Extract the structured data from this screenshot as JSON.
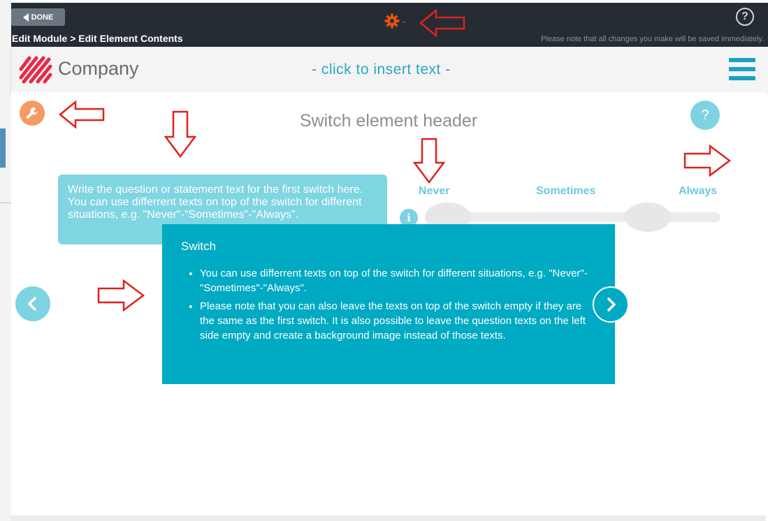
{
  "toolbar": {
    "done_label": "DONE",
    "breadcrumb": "Edit Module > Edit Element Contents",
    "help_label": "?",
    "save_note": "Please note that all changes you make will be saved immediately."
  },
  "header": {
    "company_name": "Company",
    "insert_text": "- click to insert text -"
  },
  "element": {
    "header_text": "Switch element header",
    "help_label": "?",
    "question_text": "Write the question or statement text for the first switch here. You can use differrent texts on top of the switch for different situations, e.g. \"Never\"-\"Sometimes\"-\"Always\".",
    "switch_labels": [
      "Never",
      "Sometimes",
      "Always"
    ],
    "info_label": "i"
  },
  "tooltip": {
    "title": "Switch",
    "bullets": [
      "You can use differrent texts on top of the switch for different situations, e.g. \"Never\"-\"Sometimes\"-\"Always\".",
      "Please note that you can also leave the texts on top of the switch empty if they are the same as the first switch. It is also possible to leave the question texts on the left side empty and create a background image instead of those texts."
    ]
  },
  "colors": {
    "topbar": "#252c33",
    "accent": "#00aac3",
    "accent_light": "#7ed3e2",
    "gear": "#e8530f",
    "annotation": "#e02020"
  },
  "icons": {
    "gear": "gear-icon",
    "wrench": "wrench-icon",
    "hamburger": "hamburger-menu-icon",
    "info": "info-icon",
    "prev": "chevron-left-icon",
    "next": "chevron-right-icon"
  }
}
